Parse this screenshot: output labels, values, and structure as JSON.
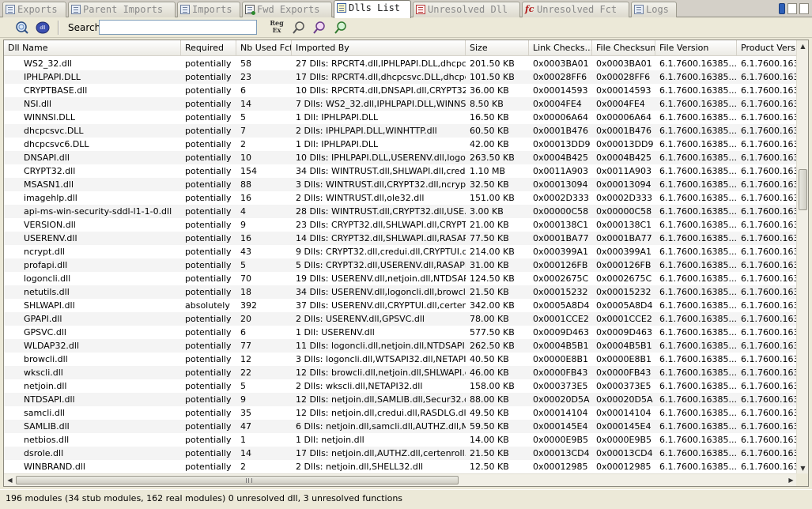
{
  "tabs": [
    {
      "label": "Exports",
      "icon": "list-icon"
    },
    {
      "label": "Parent Imports",
      "icon": "list-icon"
    },
    {
      "label": "Imports",
      "icon": "list-icon"
    },
    {
      "label": "Fwd Exports",
      "icon": "forward-icon"
    },
    {
      "label": "Dlls List",
      "icon": "list-icon",
      "active": true
    },
    {
      "label": "Unresolved Dll",
      "icon": "error-list-icon"
    },
    {
      "label": "Unresolved Fct",
      "icon": "function-icon"
    },
    {
      "label": "Logs",
      "icon": "log-icon"
    }
  ],
  "toolbar": {
    "search_label": "Search",
    "search_value": "",
    "regex_label_1": "Reg",
    "regex_label_2": "Ex"
  },
  "table": {
    "columns": [
      "Dll Name",
      "Required",
      "Nb Used Fct",
      "Imported By",
      "Size",
      "Link Checks...",
      "File Checksum",
      "File Version",
      "Product Versio"
    ],
    "rows": [
      [
        "WS2_32.dll",
        "potentially",
        "58",
        "27 Dlls: RPCRT4.dll,IPHLPAPI.DLL,dhcpc...",
        "201.50 KB",
        "0x0003BA01",
        "0x0003BA01",
        "6.1.7600.16385...",
        "6.1.7600.1638"
      ],
      [
        "IPHLPAPI.DLL",
        "potentially",
        "23",
        "17 Dlls: RPCRT4.dll,dhcpcsvc.DLL,dhcpc...",
        "101.50 KB",
        "0x00028FF6",
        "0x00028FF6",
        "6.1.7600.16385...",
        "6.1.7600.1638"
      ],
      [
        "CRYPTBASE.dll",
        "potentially",
        "6",
        "10 Dlls: RPCRT4.dll,DNSAPI.dll,CRYPT32...",
        "36.00 KB",
        "0x00014593",
        "0x00014593",
        "6.1.7600.16385...",
        "6.1.7600.1638"
      ],
      [
        "NSI.dll",
        "potentially",
        "14",
        "7 Dlls: WS2_32.dll,IPHLPAPI.DLL,WINNS...",
        "8.50 KB",
        "0x0004FE4",
        "0x0004FE4",
        "6.1.7600.16385...",
        "6.1.7600.1638"
      ],
      [
        "WINNSI.DLL",
        "potentially",
        "5",
        "1 Dll: IPHLPAPI.DLL",
        "16.50 KB",
        "0x00006A64",
        "0x00006A64",
        "6.1.7600.16385...",
        "6.1.7600.1638"
      ],
      [
        "dhcpcsvc.DLL",
        "potentially",
        "7",
        "2 Dlls: IPHLPAPI.DLL,WINHTTP.dll",
        "60.50 KB",
        "0x0001B476",
        "0x0001B476",
        "6.1.7600.16385...",
        "6.1.7600.1638"
      ],
      [
        "dhcpcsvc6.DLL",
        "potentially",
        "2",
        "1 Dll: IPHLPAPI.DLL",
        "42.00 KB",
        "0x00013DD9",
        "0x00013DD9",
        "6.1.7600.16385...",
        "6.1.7600.1638"
      ],
      [
        "DNSAPI.dll",
        "potentially",
        "10",
        "10 Dlls: IPHLPAPI.DLL,USERENV.dll,logo...",
        "263.50 KB",
        "0x0004B425",
        "0x0004B425",
        "6.1.7600.16385...",
        "6.1.7600.1638"
      ],
      [
        "CRYPT32.dll",
        "potentially",
        "154",
        "34 Dlls: WINTRUST.dll,SHLWAPI.dll,cred...",
        "1.10 MB",
        "0x0011A903",
        "0x0011A903",
        "6.1.7600.16385...",
        "6.1.7600.1638"
      ],
      [
        "MSASN1.dll",
        "potentially",
        "88",
        "3 Dlls: WINTRUST.dll,CRYPT32.dll,ncrypt...",
        "32.50 KB",
        "0x00013094",
        "0x00013094",
        "6.1.7600.16385...",
        "6.1.7600.1638"
      ],
      [
        "imagehlp.dll",
        "potentially",
        "16",
        "2 Dlls: WINTRUST.dll,ole32.dll",
        "151.00 KB",
        "0x0002D333",
        "0x0002D333",
        "6.1.7600.16385...",
        "6.1.7600.1638"
      ],
      [
        "api-ms-win-security-sddl-l1-1-0.dll",
        "potentially",
        "4",
        "28 Dlls: WINTRUST.dll,CRYPT32.dll,USE...",
        "3.00 KB",
        "0x00000C58",
        "0x00000C58",
        "6.1.7600.16385...",
        "6.1.7600.1638"
      ],
      [
        "VERSION.dll",
        "potentially",
        "9",
        "23 Dlls: CRYPT32.dll,SHLWAPI.dll,CRYPT...",
        "21.00 KB",
        "0x000138C1",
        "0x000138C1",
        "6.1.7600.16385...",
        "6.1.7600.1638"
      ],
      [
        "USERENV.dll",
        "potentially",
        "16",
        "14 Dlls: CRYPT32.dll,SHLWAPI.dll,RASAP...",
        "77.50 KB",
        "0x0001BA77",
        "0x0001BA77",
        "6.1.7600.16385...",
        "6.1.7600.1638"
      ],
      [
        "ncrypt.dll",
        "potentially",
        "43",
        "9 Dlls: CRYPT32.dll,credui.dll,CRYPTUI.dl...",
        "214.00 KB",
        "0x000399A1",
        "0x000399A1",
        "6.1.7600.16385...",
        "6.1.7600.1638"
      ],
      [
        "profapi.dll",
        "potentially",
        "5",
        "5 Dlls: CRYPT32.dll,USERENV.dll,RASAPI...",
        "31.00 KB",
        "0x000126FB",
        "0x000126FB",
        "6.1.7600.16385...",
        "6.1.7600.1638"
      ],
      [
        "logoncli.dll",
        "potentially",
        "70",
        "19 Dlls: USERENV.dll,netjoin.dll,NTDSAPI...",
        "124.50 KB",
        "0x0002675C",
        "0x0002675C",
        "6.1.7600.16385...",
        "6.1.7600.1638"
      ],
      [
        "netutils.dll",
        "potentially",
        "18",
        "34 Dlls: USERENV.dll,logoncli.dll,browcli...",
        "21.50 KB",
        "0x00015232",
        "0x00015232",
        "6.1.7600.16385...",
        "6.1.7600.1638"
      ],
      [
        "SHLWAPI.dll",
        "absolutely",
        "392",
        "37 Dlls: USERENV.dll,CRYPTUI.dll,certen...",
        "342.00 KB",
        "0x0005A8D4",
        "0x0005A8D4",
        "6.1.7600.16385...",
        "6.1.7600.1638"
      ],
      [
        "GPAPI.dll",
        "potentially",
        "20",
        "2 Dlls: USERENV.dll,GPSVC.dll",
        "78.00 KB",
        "0x0001CCE2",
        "0x0001CCE2",
        "6.1.7600.16385...",
        "6.1.7600.1638"
      ],
      [
        "GPSVC.dll",
        "potentially",
        "6",
        "1 Dll: USERENV.dll",
        "577.50 KB",
        "0x0009D463",
        "0x0009D463",
        "6.1.7600.16385...",
        "6.1.7600.1638"
      ],
      [
        "WLDAP32.dll",
        "potentially",
        "77",
        "11 Dlls: logoncli.dll,netjoin.dll,NTDSAPI.d...",
        "262.50 KB",
        "0x0004B5B1",
        "0x0004B5B1",
        "6.1.7600.16385...",
        "6.1.7600.1638"
      ],
      [
        "browcli.dll",
        "potentially",
        "12",
        "3 Dlls: logoncli.dll,WTSAPI32.dll,NETAPI3...",
        "40.50 KB",
        "0x0000E8B1",
        "0x0000E8B1",
        "6.1.7600.16385...",
        "6.1.7600.1638"
      ],
      [
        "wkscli.dll",
        "potentially",
        "22",
        "12 Dlls: browcli.dll,netjoin.dll,SHLWAPI.dl...",
        "46.00 KB",
        "0x0000FB43",
        "0x0000FB43",
        "6.1.7600.16385...",
        "6.1.7600.1638"
      ],
      [
        "netjoin.dll",
        "potentially",
        "5",
        "2 Dlls: wkscli.dll,NETAPI32.dll",
        "158.00 KB",
        "0x000373E5",
        "0x000373E5",
        "6.1.7600.16385...",
        "6.1.7600.1638"
      ],
      [
        "NTDSAPI.dll",
        "potentially",
        "9",
        "12 Dlls: netjoin.dll,SAMLIB.dll,Secur32.dll...",
        "88.00 KB",
        "0x00020D5A",
        "0x00020D5A",
        "6.1.7600.16385...",
        "6.1.7600.1638"
      ],
      [
        "samcli.dll",
        "potentially",
        "35",
        "12 Dlls: netjoin.dll,credui.dll,RASDLG.dll,...",
        "49.50 KB",
        "0x00014104",
        "0x00014104",
        "6.1.7600.16385...",
        "6.1.7600.1638"
      ],
      [
        "SAMLIB.dll",
        "potentially",
        "47",
        "6 Dlls: netjoin.dll,samcli.dll,AUTHZ.dll,MP...",
        "59.50 KB",
        "0x000145E4",
        "0x000145E4",
        "6.1.7600.16385...",
        "6.1.7600.1638"
      ],
      [
        "netbios.dll",
        "potentially",
        "1",
        "1 Dll: netjoin.dll",
        "14.00 KB",
        "0x0000E9B5",
        "0x0000E9B5",
        "6.1.7600.16385...",
        "6.1.7600.1638"
      ],
      [
        "dsrole.dll",
        "potentially",
        "14",
        "17 Dlls: netjoin.dll,AUTHZ.dll,certenroll.d...",
        "21.50 KB",
        "0x00013CD4",
        "0x00013CD4",
        "6.1.7600.16385...",
        "6.1.7600.1638"
      ],
      [
        "WINBRAND.dll",
        "potentially",
        "2",
        "2 Dlls: netjoin.dll,SHELL32.dll",
        "12.50 KB",
        "0x00012985",
        "0x00012985",
        "6.1.7600.16385...",
        "6.1.7600.1638"
      ]
    ]
  },
  "status": {
    "text": "196 modules (34 stub modules, 162 real modules) 0 unresolved dll, 3 unresolved functions"
  }
}
